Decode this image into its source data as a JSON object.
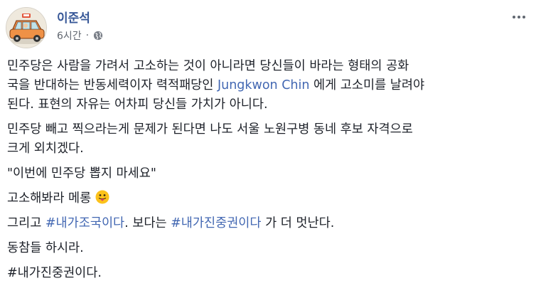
{
  "post": {
    "author": "이준석",
    "time": "6시간",
    "privacy_icon": "globe-icon",
    "more_icon": "more-options-icon",
    "paragraphs": {
      "p1_line1": "민주당은 사람을 가려서 고소하는 것이 아니라면 당신들이 바라는 형태의 공화",
      "p1_line2_pre": "국을 반대하는 반동세력이자 력적패당인 ",
      "p1_mention": "Jungkwon Chin",
      "p1_line2_post": " 에게 고소미를 날려야",
      "p1_line3": "된다. 표현의 자유는 어차피 당신들 가치가 아니다.",
      "p2_line1": "민주당 빼고 찍으라는게 문제가 된다면 나도 서울 노원구병 동네 후보 자격으로",
      "p2_line2": "크게 외치겠다.",
      "p3": "\"이번에 민주당 뽑지 마세요\"",
      "p4": "고소해봐라 메롱 ",
      "p4_emoji": "tongue-out-emoji",
      "p5_pre": "그리고 ",
      "p5_tag1": "#내가조국이다",
      "p5_mid": ". 보다는 ",
      "p5_tag2": "#내가진중권이다",
      "p5_post": " 가 더 멋난다.",
      "p6": "동참들 하시라.",
      "p7": "#내가진중권이다."
    }
  },
  "colors": {
    "link": "#4267b2",
    "author": "#385898",
    "meta": "#616770",
    "text": "#1d2129"
  }
}
